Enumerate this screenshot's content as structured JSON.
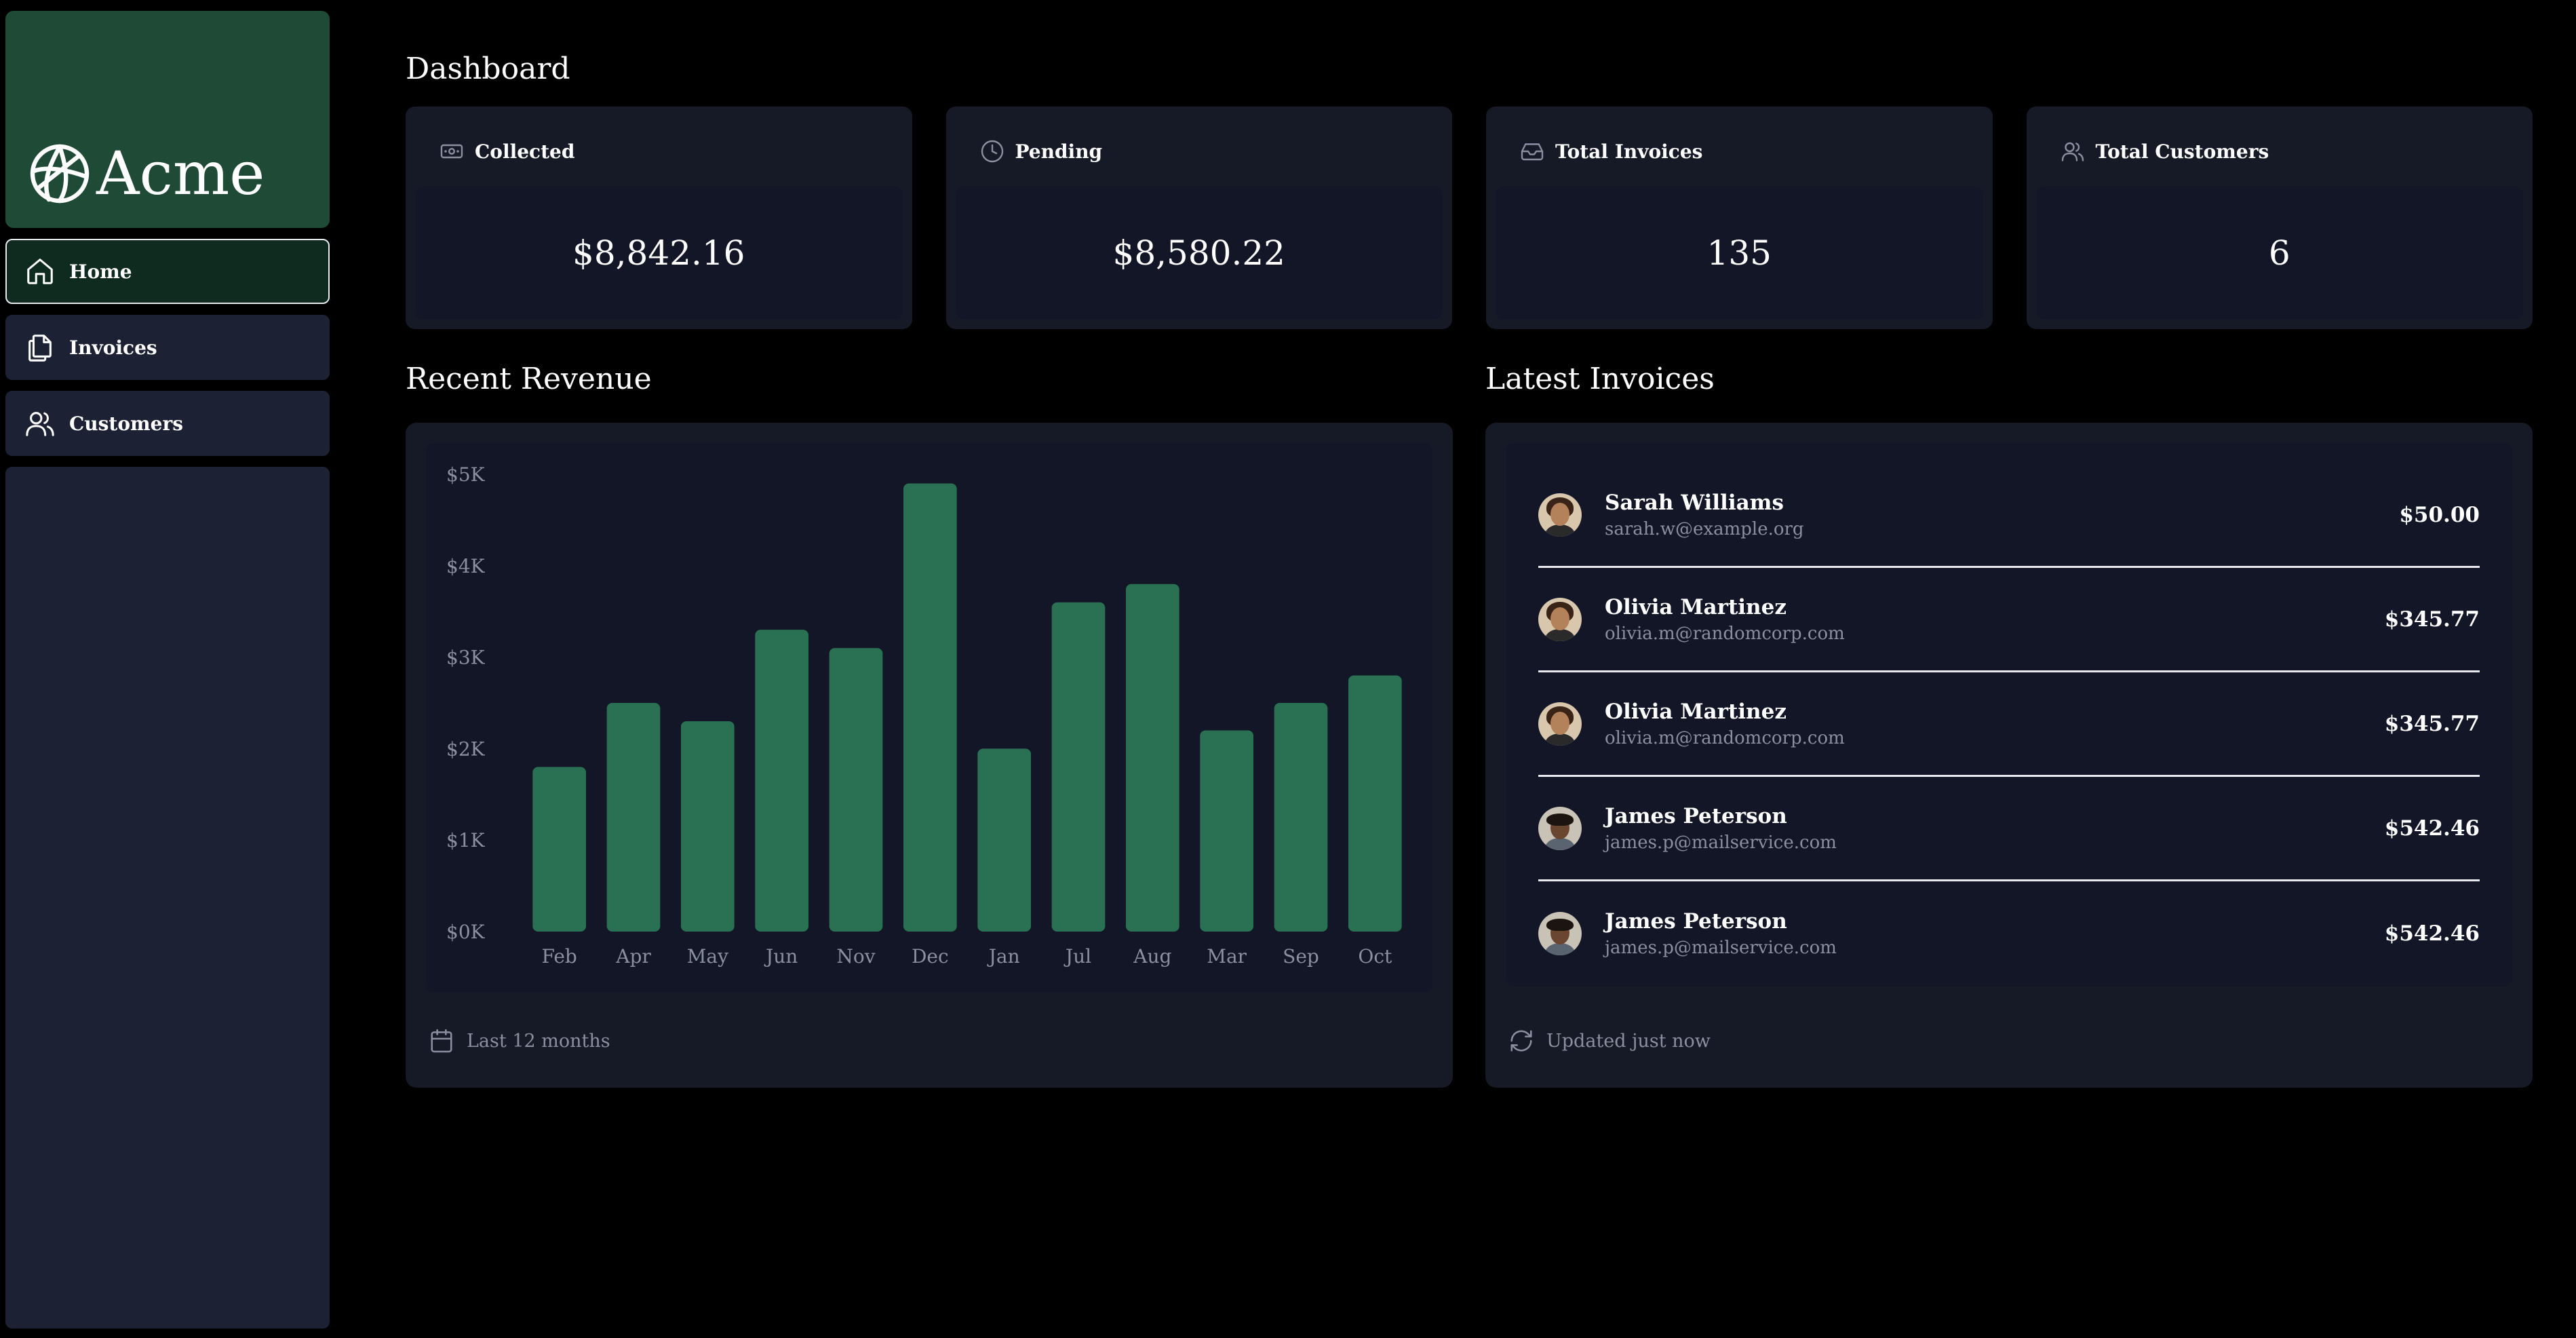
{
  "brand": {
    "name": "Acme"
  },
  "nav": [
    {
      "label": "Home",
      "active": true
    },
    {
      "label": "Invoices",
      "active": false
    },
    {
      "label": "Customers",
      "active": false
    }
  ],
  "page": {
    "title": "Dashboard"
  },
  "cards": [
    {
      "label": "Collected",
      "value": "$8,842.16",
      "icon": "banknote-icon"
    },
    {
      "label": "Pending",
      "value": "$8,580.22",
      "icon": "clock-icon"
    },
    {
      "label": "Total Invoices",
      "value": "135",
      "icon": "inbox-icon"
    },
    {
      "label": "Total Customers",
      "value": "6",
      "icon": "users-icon"
    }
  ],
  "revenue": {
    "title": "Recent Revenue",
    "footer": "Last 12 months"
  },
  "chart_data": {
    "type": "bar",
    "categories": [
      "Feb",
      "Apr",
      "May",
      "Jun",
      "Nov",
      "Dec",
      "Jan",
      "Jul",
      "Aug",
      "Mar",
      "Sep",
      "Oct"
    ],
    "values": [
      1800,
      2500,
      2300,
      3300,
      3100,
      4900,
      2000,
      3600,
      3800,
      2200,
      2500,
      2800
    ],
    "ytick_labels": [
      "$0K",
      "$1K",
      "$2K",
      "$3K",
      "$4K",
      "$5K"
    ],
    "ylim": [
      0,
      5000
    ],
    "bar_color": "#2a7052",
    "grid": false
  },
  "latest": {
    "title": "Latest Invoices",
    "footer": "Updated just now",
    "invoices": [
      {
        "name": "Sarah Williams",
        "email": "sarah.w@example.org",
        "amount": "$50.00"
      },
      {
        "name": "Olivia Martinez",
        "email": "olivia.m@randomcorp.com",
        "amount": "$345.77"
      },
      {
        "name": "Olivia Martinez",
        "email": "olivia.m@randomcorp.com",
        "amount": "$345.77"
      },
      {
        "name": "James Peterson",
        "email": "james.p@mailservice.com",
        "amount": "$542.46"
      },
      {
        "name": "James Peterson",
        "email": "james.p@mailservice.com",
        "amount": "$542.46"
      }
    ]
  },
  "colors": {
    "brand": "#1f4a36",
    "accent": "#2a7052",
    "panel": "#161a26"
  }
}
